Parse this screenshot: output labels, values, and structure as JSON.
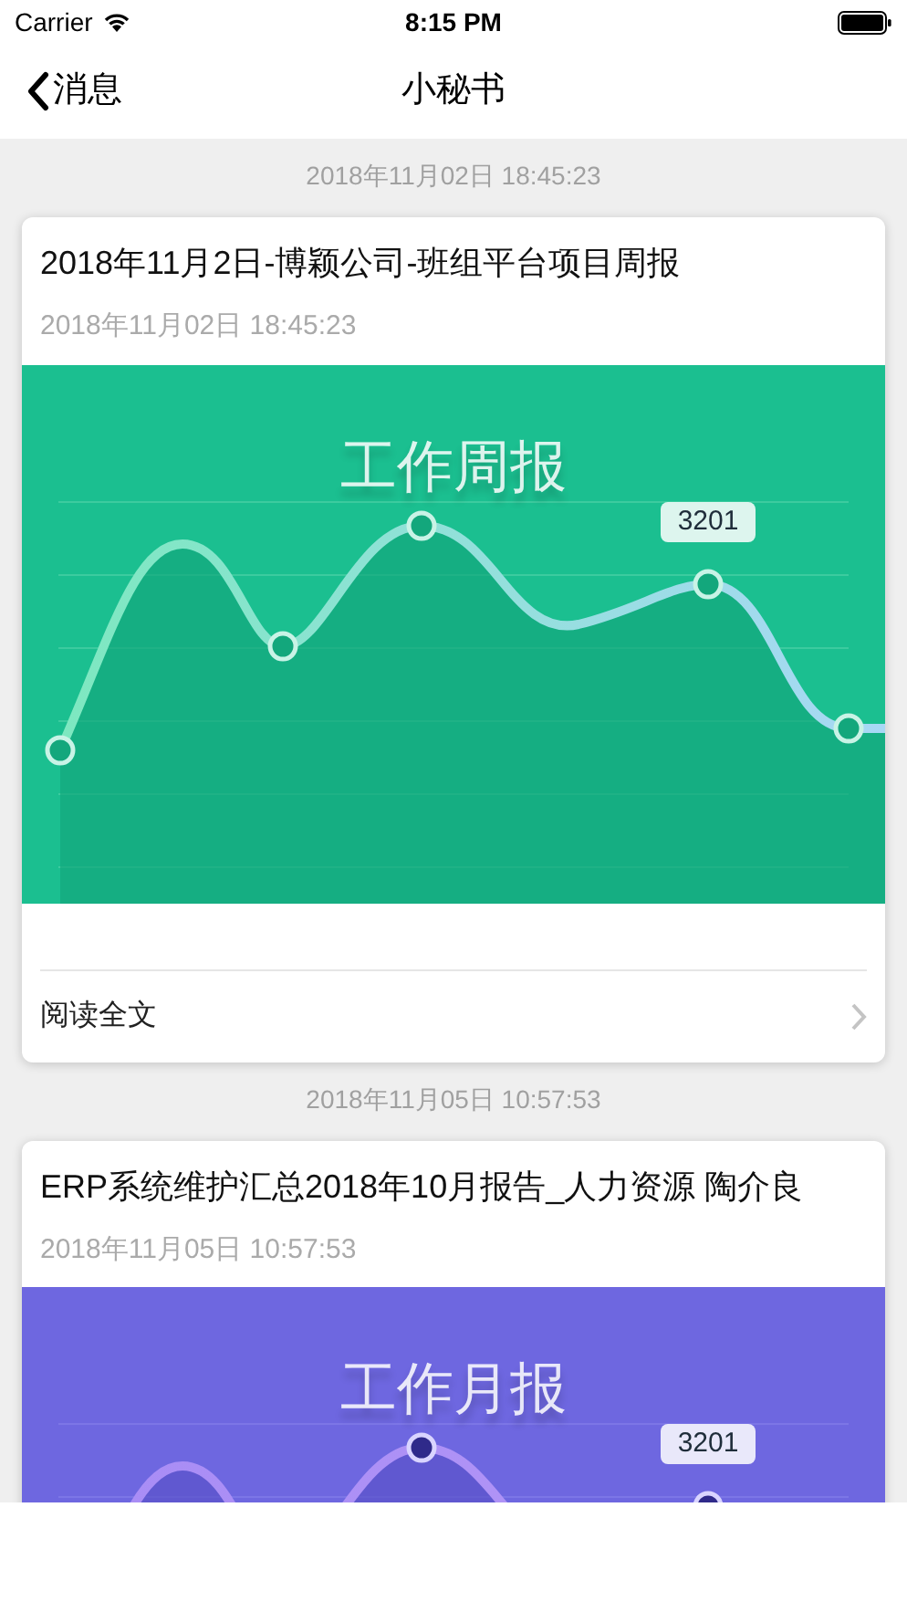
{
  "status_bar": {
    "carrier": "Carrier",
    "time": "8:15 PM"
  },
  "nav": {
    "back": "消息",
    "title": "小秘书"
  },
  "messages": [
    {
      "timestamp": "2018年11月02日 18:45:23",
      "card": {
        "title": "2018年11月2日-博颖公司-班组平台项目周报",
        "date": "2018年11月02日 18:45:23",
        "cover": {
          "color": "#1bbf90",
          "title": "工作周报",
          "callout": "3201"
        },
        "read_more": "阅读全文"
      }
    },
    {
      "timestamp": "2018年11月05日 10:57:53",
      "card": {
        "title": "ERP系统维护汇总2018年10月报告_人力资源 陶介良",
        "date": "2018年11月05日 10:57:53",
        "cover": {
          "color": "#6e67e0",
          "title": "工作月报",
          "callout": "3201"
        }
      }
    }
  ]
}
